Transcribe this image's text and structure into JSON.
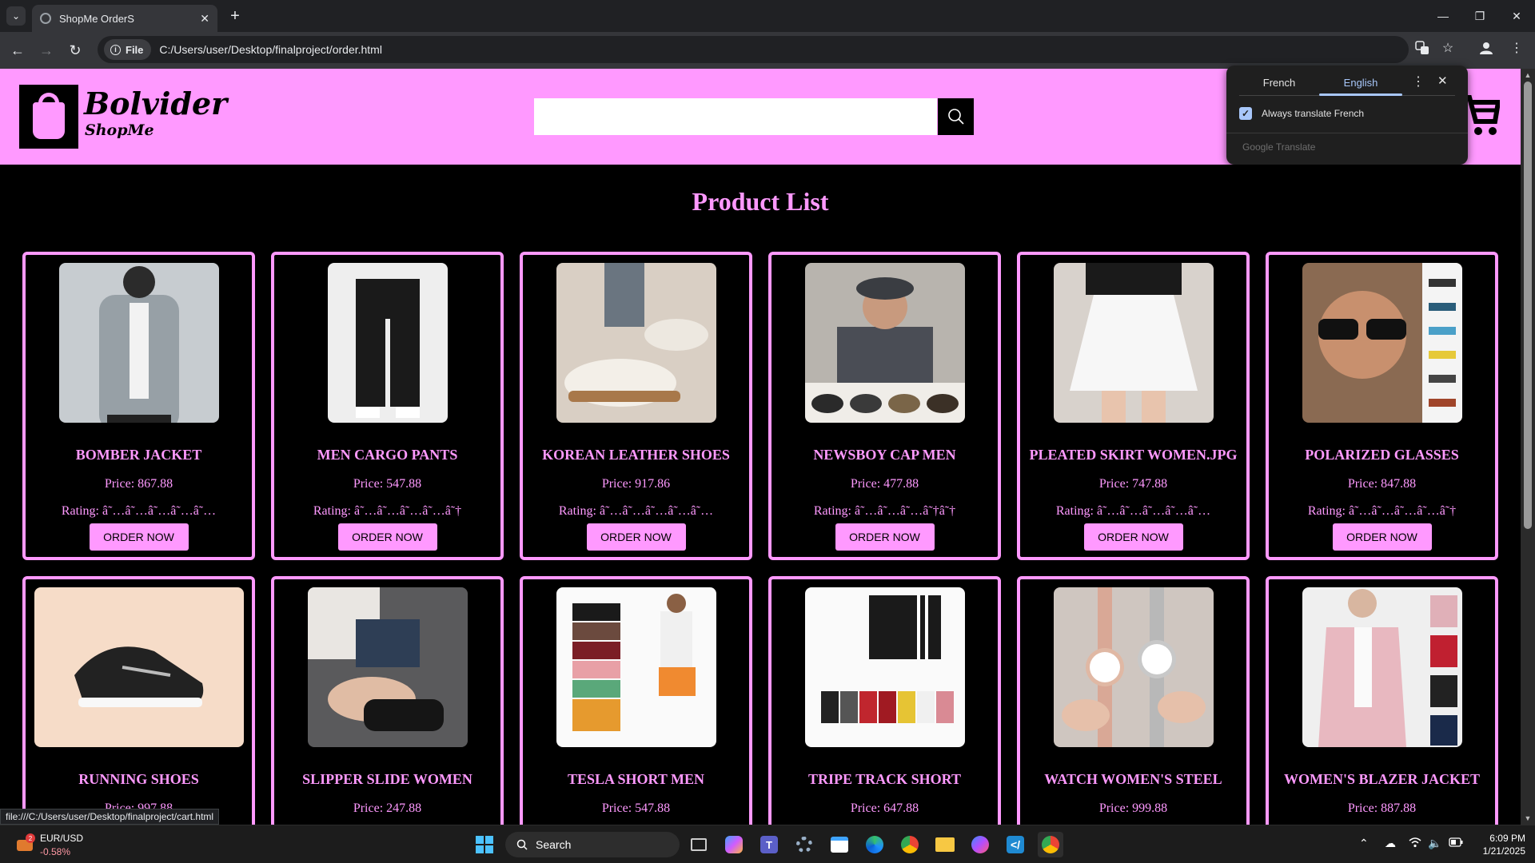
{
  "browser": {
    "tab_title": "ShopMe OrderS",
    "url": "C:/Users/user/Desktop/finalproject/order.html",
    "file_chip": "File",
    "status_url": "file:///C:/Users/user/Desktop/finalproject/cart.html"
  },
  "translate_popup": {
    "tab_source": "French",
    "tab_target": "English",
    "always_translate": "Always translate French",
    "always_translate_checked": true,
    "footer": "Google Translate"
  },
  "header": {
    "brand": "Bolvider",
    "brand_sub": "ShopMe",
    "search_value": ""
  },
  "page": {
    "heading": "Product List",
    "order_label": "ORDER NOW"
  },
  "products": [
    {
      "name": "BOMBER JACKET",
      "price": "Price: 867.88",
      "rating": "Rating: â˜…â˜…â˜…â˜…â˜…"
    },
    {
      "name": "MEN CARGO PANTS",
      "price": "Price: 547.88",
      "rating": "Rating: â˜…â˜…â˜…â˜…â˜†"
    },
    {
      "name": "KOREAN LEATHER SHOES",
      "price": "Price: 917.86",
      "rating": "Rating: â˜…â˜…â˜…â˜…â˜…"
    },
    {
      "name": "NEWSBOY CAP MEN",
      "price": "Price: 477.88",
      "rating": "Rating: â˜…â˜…â˜…â˜†â˜†"
    },
    {
      "name": "PLEATED SKIRT WOMEN.JPG",
      "price": "Price: 747.88",
      "rating": "Rating: â˜…â˜…â˜…â˜…â˜…"
    },
    {
      "name": "POLARIZED GLASSES",
      "price": "Price: 847.88",
      "rating": "Rating: â˜…â˜…â˜…â˜…â˜†"
    },
    {
      "name": "RUNNING SHOES",
      "price": "Price: 997.88",
      "rating": ""
    },
    {
      "name": "SLIPPER SLIDE WOMEN",
      "price": "Price: 247.88",
      "rating": ""
    },
    {
      "name": "TESLA SHORT MEN",
      "price": "Price: 547.88",
      "rating": ""
    },
    {
      "name": "TRIPE TRACK SHORT",
      "price": "Price: 647.88",
      "rating": ""
    },
    {
      "name": "WATCH WOMEN'S STEEL",
      "price": "Price: 999.88",
      "rating": ""
    },
    {
      "name": "WOMEN'S BLAZER JACKET",
      "price": "Price: 887.88",
      "rating": ""
    }
  ],
  "taskbar": {
    "ticker": "EUR/USD",
    "ticker_change": "-0.58%",
    "ticker_badge": "2",
    "search_label": "Search",
    "time": "6:09 PM",
    "date": "1/21/2025"
  },
  "colors": {
    "accent_pink": "#ff99ff",
    "background": "#000000"
  }
}
